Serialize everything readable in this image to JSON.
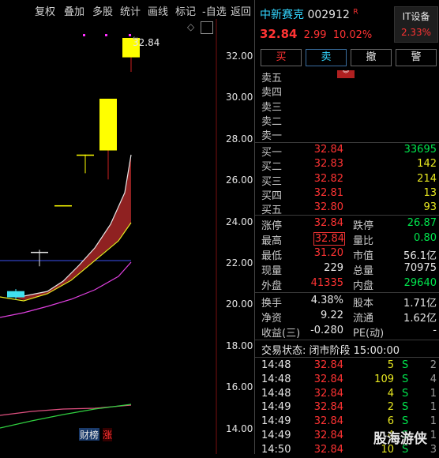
{
  "toolbar": {
    "items": [
      "复权",
      "叠加",
      "多股",
      "统计",
      "画线",
      "标记",
      "-自选",
      "返回"
    ]
  },
  "chart": {
    "price_axis": [
      "32.00",
      "30.00",
      "28.00",
      "26.00",
      "24.00",
      "22.00",
      "20.00",
      "18.00",
      "16.00",
      "14.00"
    ],
    "high_label": "32.84",
    "badges": [
      "财",
      "榜",
      "涨"
    ],
    "diamond": "◇"
  },
  "chart_data": {
    "type": "candlestick",
    "y_axis_ticks": [
      14,
      16,
      18,
      20,
      22,
      24,
      26,
      28,
      30,
      32
    ],
    "annotation": "32.84",
    "candles": [
      {
        "open": 20.3,
        "close": 20.6,
        "high": 20.7,
        "low": 20.2,
        "color": "cyan"
      },
      {
        "open": 22.5,
        "close": 22.5,
        "high": 22.6,
        "low": 21.8,
        "color": "white"
      },
      {
        "open": 24.75,
        "close": 24.75,
        "high": 24.75,
        "low": 24.75,
        "color": "yellow"
      },
      {
        "open": 27.2,
        "close": 27.2,
        "high": 27.2,
        "low": 26.3,
        "color": "yellow"
      },
      {
        "open": 27.4,
        "close": 29.9,
        "high": 29.9,
        "low": 26.0,
        "color": "yellow"
      },
      {
        "open": 31.9,
        "close": 32.84,
        "high": 32.84,
        "low": 31.2,
        "color": "yellow"
      }
    ],
    "reference_line": 22.2
  },
  "quote": {
    "name": "中新赛克",
    "code": "002912",
    "r_mark": "R",
    "sector": "IT设备",
    "sector_change": "2.33%",
    "price": "32.84",
    "change": "2.99",
    "change_pct": "10.02%",
    "buttons": {
      "buy": "买",
      "sell": "卖",
      "cancel": "撤",
      "alert": "警"
    },
    "expand_icon": "︾",
    "sell_levels": [
      {
        "label": "卖五",
        "price": "",
        "vol": ""
      },
      {
        "label": "卖四",
        "price": "",
        "vol": ""
      },
      {
        "label": "卖三",
        "price": "",
        "vol": ""
      },
      {
        "label": "卖二",
        "price": "",
        "vol": ""
      },
      {
        "label": "卖一",
        "price": "",
        "vol": ""
      }
    ],
    "buy_levels": [
      {
        "label": "买一",
        "price": "32.84",
        "vol": "33695"
      },
      {
        "label": "买二",
        "price": "32.83",
        "vol": "142"
      },
      {
        "label": "买三",
        "price": "32.82",
        "vol": "214"
      },
      {
        "label": "买四",
        "price": "32.81",
        "vol": "13"
      },
      {
        "label": "买五",
        "price": "32.80",
        "vol": "93"
      }
    ],
    "stats": {
      "zt_label": "涨停",
      "zt": "32.84",
      "dt_label": "跌停",
      "dt": "26.87",
      "high_label": "最高",
      "high": "32.84",
      "lb_label": "量比",
      "lb": "0.80",
      "low_label": "最低",
      "low": "31.20",
      "sz_label": "市值",
      "sz": "56.1亿",
      "xl_label": "现量",
      "xl": "229",
      "zl_label": "总量",
      "zl": "70975",
      "wp_label": "外盘",
      "wp": "41335",
      "np_label": "内盘",
      "np": "29640"
    },
    "fin": {
      "hs_label": "换手",
      "hs": "4.38%",
      "gb_label": "股本",
      "gb": "1.71亿",
      "jz_label": "净资",
      "jz": "9.22",
      "lt_label": "流通",
      "lt": "1.62亿",
      "sy_label": "收益(三)",
      "sy": "-0.280",
      "pe_label": "PE(动)",
      "pe": "-"
    },
    "status": "交易状态: 闭市阶段 15:00:00",
    "ticks": [
      {
        "time": "14:48",
        "price": "32.84",
        "vol": "5",
        "side": "S",
        "n": "2"
      },
      {
        "time": "14:48",
        "price": "32.84",
        "vol": "109",
        "side": "S",
        "n": "4"
      },
      {
        "time": "14:48",
        "price": "32.84",
        "vol": "4",
        "side": "S",
        "n": "1"
      },
      {
        "time": "14:49",
        "price": "32.84",
        "vol": "2",
        "side": "S",
        "n": "1"
      },
      {
        "time": "14:49",
        "price": "32.84",
        "vol": "6",
        "side": "S",
        "n": "1"
      },
      {
        "time": "14:49",
        "price": "32.84",
        "vol": "4",
        "side": "S",
        "n": "1"
      },
      {
        "time": "14:50",
        "price": "32.84",
        "vol": "10",
        "side": "S",
        "n": "3"
      }
    ],
    "watermark": "股海游侠"
  }
}
